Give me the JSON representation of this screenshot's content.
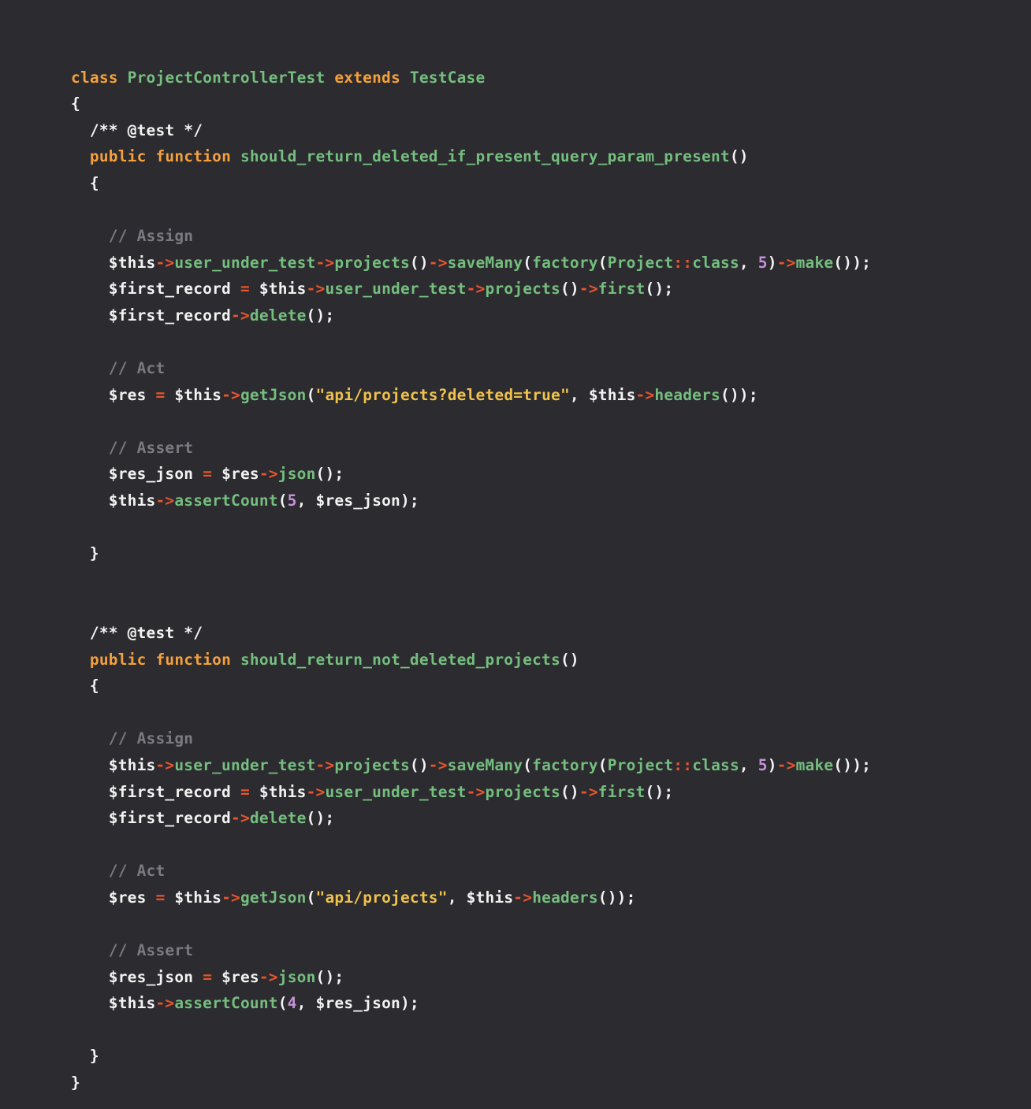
{
  "editor": {
    "language": "php",
    "theme": {
      "background": "#2b2b30",
      "foreground": "#f2f2f2",
      "keyword": "#f5a03c",
      "class_name": "#75be7e",
      "function": "#75be7e",
      "operator": "#e8552d",
      "string": "#f0c14b",
      "number": "#c792d8",
      "comment": "#7a7a80"
    }
  },
  "code": {
    "class_declaration": {
      "keyword_class": "class",
      "class_name": "ProjectControllerTest",
      "keyword_extends": "extends",
      "parent_class": "TestCase"
    },
    "brace_open_class": "{",
    "brace_close_class": "}",
    "tests": [
      {
        "docblock": "/** @test */",
        "modifier": "public",
        "keyword_function": "function",
        "name": "should_return_deleted_if_present_query_param_present",
        "parens": "()",
        "brace_open": "{",
        "brace_close": "}",
        "sections": {
          "assign_comment": "// Assign",
          "act_comment": "// Act",
          "assert_comment": "// Assert"
        },
        "assign": {
          "line1": {
            "var": "$this",
            "arrow1": "->",
            "prop": "user_under_test",
            "arrow2": "->",
            "method1": "projects",
            "call1": "()",
            "arrow3": "->",
            "method2": "saveMany",
            "open": "(",
            "factory": "factory",
            "open2": "(",
            "model": "Project",
            "scope": "::",
            "const": "class",
            "comma": ", ",
            "count": "5",
            "close2": ")",
            "arrow4": "->",
            "method3": "make",
            "call2": "()",
            "close": ");"
          },
          "line2": {
            "var": "$first_record",
            "eq": "=",
            "var2": "$this",
            "arrow1": "->",
            "prop": "user_under_test",
            "arrow2": "->",
            "method1": "projects",
            "call1": "()",
            "arrow3": "->",
            "method2": "first",
            "close": "();"
          },
          "line3": {
            "var": "$first_record",
            "arrow": "->",
            "method": "delete",
            "close": "();"
          }
        },
        "act": {
          "var": "$res",
          "eq": "=",
          "var2": "$this",
          "arrow": "->",
          "method": "getJson",
          "open": "(",
          "url": "\"api/projects?deleted=true\"",
          "comma": ", ",
          "var3": "$this",
          "arrow2": "->",
          "method2": "headers",
          "close": "());"
        },
        "assert": {
          "line1": {
            "var": "$res_json",
            "eq": "=",
            "var2": "$res",
            "arrow": "->",
            "method": "json",
            "close": "();"
          },
          "line2": {
            "var": "$this",
            "arrow": "->",
            "method": "assertCount",
            "open": "(",
            "expected": "5",
            "comma": ", ",
            "actual": "$res_json",
            "close": ");"
          }
        }
      },
      {
        "docblock": "/** @test */",
        "modifier": "public",
        "keyword_function": "function",
        "name": "should_return_not_deleted_projects",
        "parens": "()",
        "brace_open": "{",
        "brace_close": "}",
        "sections": {
          "assign_comment": "// Assign",
          "act_comment": "// Act",
          "assert_comment": "// Assert"
        },
        "assign": {
          "line1": {
            "var": "$this",
            "arrow1": "->",
            "prop": "user_under_test",
            "arrow2": "->",
            "method1": "projects",
            "call1": "()",
            "arrow3": "->",
            "method2": "saveMany",
            "open": "(",
            "factory": "factory",
            "open2": "(",
            "model": "Project",
            "scope": "::",
            "const": "class",
            "comma": ", ",
            "count": "5",
            "close2": ")",
            "arrow4": "->",
            "method3": "make",
            "call2": "()",
            "close": ");"
          },
          "line2": {
            "var": "$first_record",
            "eq": "=",
            "var2": "$this",
            "arrow1": "->",
            "prop": "user_under_test",
            "arrow2": "->",
            "method1": "projects",
            "call1": "()",
            "arrow3": "->",
            "method2": "first",
            "close": "();"
          },
          "line3": {
            "var": "$first_record",
            "arrow": "->",
            "method": "delete",
            "close": "();"
          }
        },
        "act": {
          "var": "$res",
          "eq": "=",
          "var2": "$this",
          "arrow": "->",
          "method": "getJson",
          "open": "(",
          "url": "\"api/projects\"",
          "comma": ", ",
          "var3": "$this",
          "arrow2": "->",
          "method2": "headers",
          "close": "());"
        },
        "assert": {
          "line1": {
            "var": "$res_json",
            "eq": "=",
            "var2": "$res",
            "arrow": "->",
            "method": "json",
            "close": "();"
          },
          "line2": {
            "var": "$this",
            "arrow": "->",
            "method": "assertCount",
            "open": "(",
            "expected": "4",
            "comma": ", ",
            "actual": "$res_json",
            "close": ");"
          }
        }
      }
    ]
  }
}
